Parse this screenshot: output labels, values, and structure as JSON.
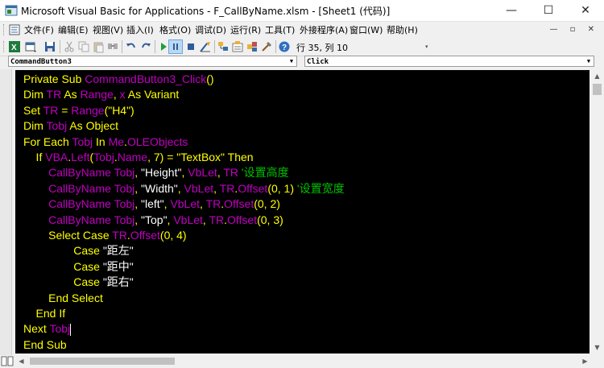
{
  "window": {
    "title": "Microsoft Visual Basic for Applications - F_CallByName.xlsm - [Sheet1 (代码)]",
    "minimize": "—",
    "maximize": "☐",
    "close": "✕"
  },
  "menu": {
    "items": [
      "文件(F)",
      "编辑(E)",
      "视图(V)",
      "插入(I)",
      "格式(O)",
      "调试(D)",
      "运行(R)",
      "工具(T)",
      "外接程序(A)",
      "窗口(W)",
      "帮助(H)"
    ],
    "mdi_controls": "— ▫ ✕"
  },
  "toolbar": {
    "icons": [
      "excel-view-icon",
      "insert-module-icon",
      "save-icon",
      "cut-icon",
      "copy-icon",
      "paste-icon",
      "find-icon",
      "undo-icon",
      "redo-icon",
      "run-icon",
      "break-icon",
      "reset-icon",
      "design-mode-icon",
      "project-explorer-icon",
      "properties-icon",
      "object-browser-icon",
      "toolbox-icon",
      "help-icon"
    ],
    "cursor_position": "行 35, 列 10"
  },
  "object_combo": {
    "value": "CommandButton3"
  },
  "procedure_combo": {
    "value": "Click"
  },
  "code": {
    "lines": [
      [
        {
          "t": "Private Sub ",
          "c": "kw"
        },
        {
          "t": "CommandButton3_Click",
          "c": "id"
        },
        {
          "t": "()",
          "c": "kw"
        }
      ],
      [
        {
          "t": "Dim ",
          "c": "kw"
        },
        {
          "t": "TR",
          "c": "id"
        },
        {
          "t": " As ",
          "c": "kw"
        },
        {
          "t": "Range",
          "c": "id"
        },
        {
          "t": ", ",
          "c": "kw"
        },
        {
          "t": "x",
          "c": "id"
        },
        {
          "t": " As Variant",
          "c": "kw"
        }
      ],
      [
        {
          "t": "Set ",
          "c": "kw"
        },
        {
          "t": "TR",
          "c": "id"
        },
        {
          "t": " = ",
          "c": "kw"
        },
        {
          "t": "Range",
          "c": "id"
        },
        {
          "t": "(\"H4\")",
          "c": "kw"
        }
      ],
      [
        {
          "t": "Dim ",
          "c": "kw"
        },
        {
          "t": "Tobj",
          "c": "id"
        },
        {
          "t": " As Object",
          "c": "kw"
        }
      ],
      [
        {
          "t": "For Each ",
          "c": "kw"
        },
        {
          "t": "Tobj",
          "c": "id"
        },
        {
          "t": " In ",
          "c": "kw"
        },
        {
          "t": "Me",
          "c": "id"
        },
        {
          "t": ".",
          "c": "kw"
        },
        {
          "t": "OLEObjects",
          "c": "id"
        }
      ],
      [
        {
          "t": "    If ",
          "c": "kw"
        },
        {
          "t": "VBA",
          "c": "id"
        },
        {
          "t": ".",
          "c": "kw"
        },
        {
          "t": "Left",
          "c": "id"
        },
        {
          "t": "(",
          "c": "kw"
        },
        {
          "t": "Tobj",
          "c": "id"
        },
        {
          "t": ".",
          "c": "kw"
        },
        {
          "t": "Name",
          "c": "id"
        },
        {
          "t": ", 7) = \"TextBox\" Then",
          "c": "kw"
        }
      ],
      [
        {
          "t": "        CallByName ",
          "c": "id"
        },
        {
          "t": "Tobj",
          "c": "id"
        },
        {
          "t": ", ",
          "c": "kw"
        },
        {
          "t": "\"Height\"",
          "c": "str2"
        },
        {
          "t": ", ",
          "c": "kw"
        },
        {
          "t": "VbLet",
          "c": "id"
        },
        {
          "t": ", ",
          "c": "kw"
        },
        {
          "t": "TR",
          "c": "id"
        },
        {
          "t": " '设置高度",
          "c": "cmt"
        }
      ],
      [
        {
          "t": "        CallByName ",
          "c": "id"
        },
        {
          "t": "Tobj",
          "c": "id"
        },
        {
          "t": ", ",
          "c": "kw"
        },
        {
          "t": "\"Width\"",
          "c": "str2"
        },
        {
          "t": ", ",
          "c": "kw"
        },
        {
          "t": "VbLet",
          "c": "id"
        },
        {
          "t": ", ",
          "c": "kw"
        },
        {
          "t": "TR",
          "c": "id"
        },
        {
          "t": ".",
          "c": "kw"
        },
        {
          "t": "Offset",
          "c": "id"
        },
        {
          "t": "(0, 1)",
          "c": "kw"
        },
        {
          "t": " '设置宽度",
          "c": "cmt"
        }
      ],
      [
        {
          "t": "        CallByName ",
          "c": "id"
        },
        {
          "t": "Tobj",
          "c": "id"
        },
        {
          "t": ", ",
          "c": "kw"
        },
        {
          "t": "\"left\"",
          "c": "str2"
        },
        {
          "t": ", ",
          "c": "kw"
        },
        {
          "t": "VbLet",
          "c": "id"
        },
        {
          "t": ", ",
          "c": "kw"
        },
        {
          "t": "TR",
          "c": "id"
        },
        {
          "t": ".",
          "c": "kw"
        },
        {
          "t": "Offset",
          "c": "id"
        },
        {
          "t": "(0, 2)",
          "c": "kw"
        }
      ],
      [
        {
          "t": "        CallByName ",
          "c": "id"
        },
        {
          "t": "Tobj",
          "c": "id"
        },
        {
          "t": ", ",
          "c": "kw"
        },
        {
          "t": "\"Top\"",
          "c": "str2"
        },
        {
          "t": ", ",
          "c": "kw"
        },
        {
          "t": "VbLet",
          "c": "id"
        },
        {
          "t": ", ",
          "c": "kw"
        },
        {
          "t": "TR",
          "c": "id"
        },
        {
          "t": ".",
          "c": "kw"
        },
        {
          "t": "Offset",
          "c": "id"
        },
        {
          "t": "(0, 3)",
          "c": "kw"
        }
      ],
      [
        {
          "t": "        Select Case ",
          "c": "kw"
        },
        {
          "t": "TR",
          "c": "id"
        },
        {
          "t": ".",
          "c": "kw"
        },
        {
          "t": "Offset",
          "c": "id"
        },
        {
          "t": "(0, 4)",
          "c": "kw"
        }
      ],
      [
        {
          "t": "                Case ",
          "c": "kw"
        },
        {
          "t": "\"距左\"",
          "c": "str2"
        }
      ],
      [
        {
          "t": "                Case ",
          "c": "kw"
        },
        {
          "t": "\"距中\"",
          "c": "str2"
        }
      ],
      [
        {
          "t": "                Case ",
          "c": "kw"
        },
        {
          "t": "\"距右\"",
          "c": "str2"
        }
      ],
      [
        {
          "t": "        End Select",
          "c": "kw"
        }
      ],
      [
        {
          "t": "    End If",
          "c": "kw"
        }
      ],
      [
        {
          "t": "Next ",
          "c": "kw"
        },
        {
          "t": "Tobj",
          "c": "id"
        },
        {
          "t": "",
          "c": "caret"
        }
      ],
      [
        {
          "t": "End Sub",
          "c": "kw"
        }
      ]
    ]
  },
  "colors": {
    "keyword": "#ffff00",
    "identifier": "#c000c0",
    "comment": "#00c000",
    "editor_background": "#000000"
  }
}
